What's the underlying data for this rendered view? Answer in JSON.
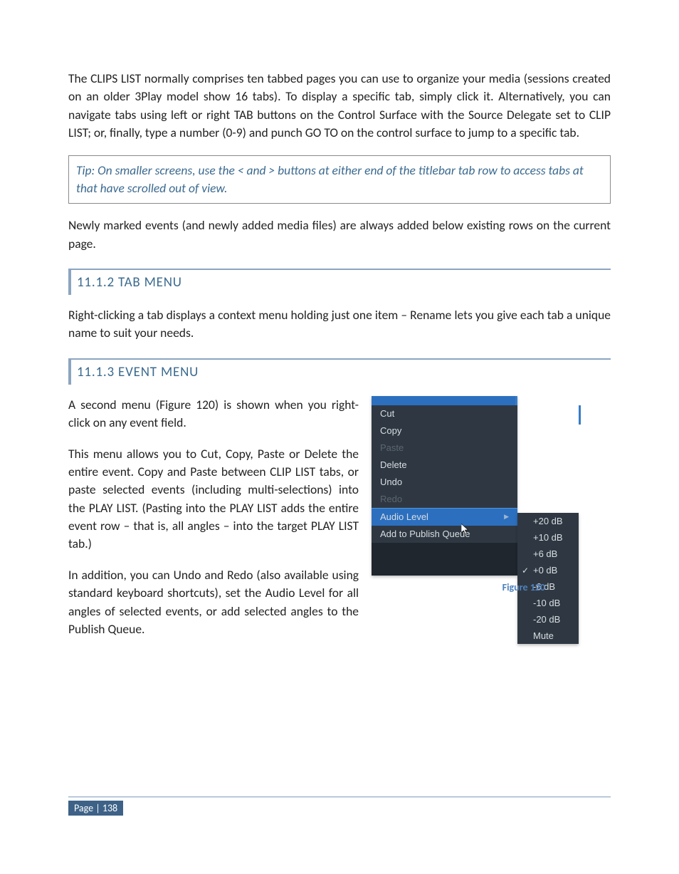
{
  "p1": "The CLIPS LIST normally comprises ten tabbed pages you can use to organize your media (sessions created on an older 3Play model show 16 tabs). To display a specific tab, simply click it. Alternatively, you can navigate tabs using left or right TAB buttons on the Control Surface with the Source Delegate set to CLIP LIST; or, finally, type a number (0-9) and punch GO TO on the control surface to jump to a specific tab.",
  "tip": "Tip: On smaller screens, use the < and > buttons at either end of the titlebar tab row to access tabs at that have scrolled out of view.",
  "p2": "Newly marked events (and newly added media files) are always added below existing rows on the current page.",
  "h1": "11.1.2 TAB MENU",
  "p3": "Right-clicking a tab displays a context menu holding just one item – Rename lets you give each tab a unique name to suit your needs.",
  "h2": "11.1.3 EVENT MENU",
  "p4": "A second menu (Figure 120) is shown when you right-click on any event field.",
  "p5": "This menu allows you to Cut, Copy, Paste or Delete the entire event.  Copy and Paste between CLIP LIST tabs, or paste selected events (including multi-selections) into the PLAY LIST.  (Pasting into the PLAY LIST adds the entire event row – that is, all angles – into the target PLAY LIST tab.)",
  "p6": "In addition, you can Undo and Redo (also available using standard keyboard shortcuts), set the Audio Level for all angles of selected events, or add selected angles to the Publish Queue.",
  "menu": {
    "cut": "Cut",
    "copy": "Copy",
    "paste": "Paste",
    "delete": "Delete",
    "undo": "Undo",
    "redo": "Redo",
    "audio": "Audio Level",
    "publish": "Add to Publish Queue"
  },
  "submenu": {
    "p20": "+20 dB",
    "p10": "+10 dB",
    "p6": "+6 dB",
    "p0": "+0 dB",
    "m6": "-6 dB",
    "m10": "-10 dB",
    "m20": "-20 dB",
    "mute": "Mute"
  },
  "caption": "Figure 120",
  "page": "Page | 138"
}
